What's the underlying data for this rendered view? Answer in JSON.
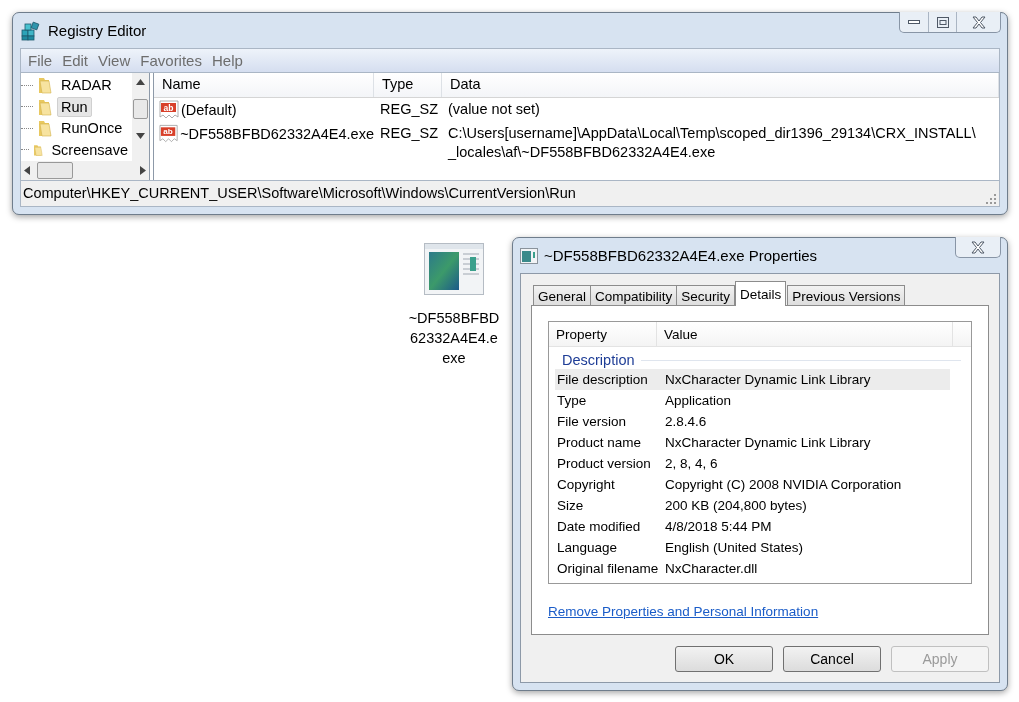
{
  "registry_editor": {
    "title": "Registry Editor",
    "menu": [
      "File",
      "Edit",
      "View",
      "Favorites",
      "Help"
    ],
    "tree": [
      {
        "label": "RADAR",
        "selected": false
      },
      {
        "label": "Run",
        "selected": true
      },
      {
        "label": "RunOnce",
        "selected": false
      },
      {
        "label": "Screensave",
        "selected": false
      }
    ],
    "columns": [
      "Name",
      "Type",
      "Data"
    ],
    "rows": [
      {
        "icon_text": "ab",
        "name": "(Default)",
        "type": "REG_SZ",
        "data": [
          "(value not set)"
        ]
      },
      {
        "icon_text": "ab",
        "name": "~DF558BFBD62332A4E4.exe",
        "type": "REG_SZ",
        "data": [
          "C:\\Users[username]\\AppData\\Local\\Temp\\scoped_dir1396_29134\\CRX_INSTALL\\",
          "_locales\\af\\~DF558BFBD62332A4E4.exe"
        ]
      }
    ],
    "status_bar": "Computer\\HKEY_CURRENT_USER\\Software\\Microsoft\\Windows\\CurrentVersion\\Run"
  },
  "desktop_icon": {
    "label_lines": [
      "~DF558BFBD",
      "62332A4E4.e",
      "exe"
    ]
  },
  "properties": {
    "title": "~DF558BFBD62332A4E4.exe Properties",
    "tabs": [
      {
        "label": "General",
        "selected": false
      },
      {
        "label": "Compatibility",
        "selected": false
      },
      {
        "label": "Security",
        "selected": false
      },
      {
        "label": "Details",
        "selected": true
      },
      {
        "label": "Previous Versions",
        "selected": false
      }
    ],
    "columns": [
      "Property",
      "Value"
    ],
    "group": "Description",
    "rows": [
      {
        "property": "File description",
        "value": "NxCharacter Dynamic Link Library",
        "selected": true
      },
      {
        "property": "Type",
        "value": "Application",
        "selected": false
      },
      {
        "property": "File version",
        "value": "2.8.4.6",
        "selected": false
      },
      {
        "property": "Product name",
        "value": "NxCharacter Dynamic Link Library",
        "selected": false
      },
      {
        "property": "Product version",
        "value": "2, 8, 4, 6",
        "selected": false
      },
      {
        "property": "Copyright",
        "value": "Copyright (C) 2008 NVIDIA Corporation",
        "selected": false
      },
      {
        "property": "Size",
        "value": "200 KB (204,800 bytes)",
        "selected": false
      },
      {
        "property": "Date modified",
        "value": "4/8/2018 5:44 PM",
        "selected": false
      },
      {
        "property": "Language",
        "value": "English (United States)",
        "selected": false
      },
      {
        "property": "Original filename",
        "value": "NxCharacter.dll",
        "selected": false
      }
    ],
    "link": "Remove Properties and Personal Information",
    "buttons": [
      {
        "label": "OK",
        "disabled": false
      },
      {
        "label": "Cancel",
        "disabled": false
      },
      {
        "label": "Apply",
        "disabled": true
      }
    ]
  }
}
